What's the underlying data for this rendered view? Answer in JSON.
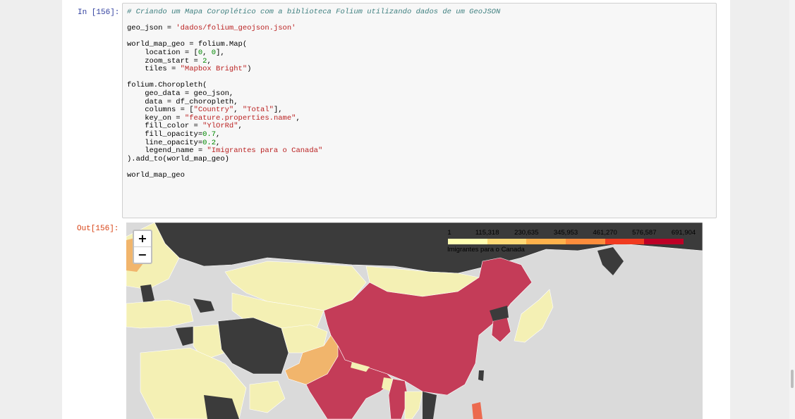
{
  "cell": {
    "in_prompt": "In [156]:",
    "out_prompt": "Out[156]:",
    "code_lines": [
      [
        {
          "t": "# Criando um Mapa Coroplético com a biblioteca Folium utilizando dados de um GeoJSON",
          "c": "com"
        }
      ],
      [],
      [
        {
          "t": "geo_json = ",
          "c": ""
        },
        {
          "t": "'dados/folium_geojson.json'",
          "c": "str"
        }
      ],
      [],
      [
        {
          "t": "world_map_geo = folium.Map(",
          "c": ""
        }
      ],
      [
        {
          "t": "    location = [",
          "c": ""
        },
        {
          "t": "0",
          "c": "num"
        },
        {
          "t": ", ",
          "c": ""
        },
        {
          "t": "0",
          "c": "num"
        },
        {
          "t": "],",
          "c": ""
        }
      ],
      [
        {
          "t": "    zoom_start = ",
          "c": ""
        },
        {
          "t": "2",
          "c": "num"
        },
        {
          "t": ",",
          "c": ""
        }
      ],
      [
        {
          "t": "    tiles = ",
          "c": ""
        },
        {
          "t": "\"Mapbox Bright\"",
          "c": "str"
        },
        {
          "t": ")",
          "c": ""
        }
      ],
      [],
      [
        {
          "t": "folium.Choropleth(",
          "c": ""
        }
      ],
      [
        {
          "t": "    geo_data = geo_json,",
          "c": ""
        }
      ],
      [
        {
          "t": "    data = df_choropleth,",
          "c": ""
        }
      ],
      [
        {
          "t": "    columns = [",
          "c": ""
        },
        {
          "t": "\"Country\"",
          "c": "str"
        },
        {
          "t": ", ",
          "c": ""
        },
        {
          "t": "\"Total\"",
          "c": "str"
        },
        {
          "t": "],",
          "c": ""
        }
      ],
      [
        {
          "t": "    key_on = ",
          "c": ""
        },
        {
          "t": "\"feature.properties.name\"",
          "c": "str"
        },
        {
          "t": ",",
          "c": ""
        }
      ],
      [
        {
          "t": "    fill_color = ",
          "c": ""
        },
        {
          "t": "\"YlOrRd\"",
          "c": "str"
        },
        {
          "t": ",",
          "c": ""
        }
      ],
      [
        {
          "t": "    fill_opacity=",
          "c": ""
        },
        {
          "t": "0.7",
          "c": "num"
        },
        {
          "t": ",",
          "c": ""
        }
      ],
      [
        {
          "t": "    line_opacity=",
          "c": ""
        },
        {
          "t": "0.2",
          "c": "num"
        },
        {
          "t": ",",
          "c": ""
        }
      ],
      [
        {
          "t": "    legend_name = ",
          "c": ""
        },
        {
          "t": "\"Imigrantes para o Canada\"",
          "c": "str"
        }
      ],
      [
        {
          "t": ").add_to(world_map_geo)",
          "c": ""
        }
      ],
      [],
      [
        {
          "t": "world_map_geo",
          "c": ""
        }
      ]
    ]
  },
  "map": {
    "zoom_in_label": "+",
    "zoom_out_label": "−",
    "colors": {
      "background": "#dadada",
      "no_data": "#3b3b3b",
      "low": "#f4f0b4",
      "mid": "#f1b56c",
      "high": "#c43c58",
      "orange_red": "#ec6a4f"
    },
    "legend": {
      "ticks": [
        "1",
        "115,318",
        "230,635",
        "345,953",
        "461,270",
        "576,587",
        "691,904"
      ],
      "colors": [
        "#ffffb2",
        "#fed976",
        "#feb24c",
        "#fd8d3c",
        "#f03b20",
        "#bd0026"
      ],
      "caption": "Imigrantes para o Canada"
    }
  }
}
